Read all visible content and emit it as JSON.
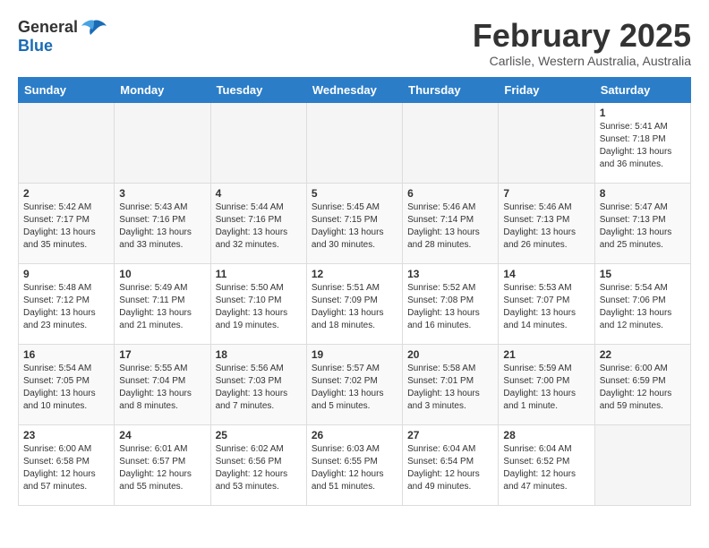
{
  "header": {
    "logo_general": "General",
    "logo_blue": "Blue",
    "title": "February 2025",
    "subtitle": "Carlisle, Western Australia, Australia"
  },
  "calendar": {
    "days_of_week": [
      "Sunday",
      "Monday",
      "Tuesday",
      "Wednesday",
      "Thursday",
      "Friday",
      "Saturday"
    ],
    "weeks": [
      [
        {
          "day": "",
          "info": ""
        },
        {
          "day": "",
          "info": ""
        },
        {
          "day": "",
          "info": ""
        },
        {
          "day": "",
          "info": ""
        },
        {
          "day": "",
          "info": ""
        },
        {
          "day": "",
          "info": ""
        },
        {
          "day": "1",
          "info": "Sunrise: 5:41 AM\nSunset: 7:18 PM\nDaylight: 13 hours\nand 36 minutes."
        }
      ],
      [
        {
          "day": "2",
          "info": "Sunrise: 5:42 AM\nSunset: 7:17 PM\nDaylight: 13 hours\nand 35 minutes."
        },
        {
          "day": "3",
          "info": "Sunrise: 5:43 AM\nSunset: 7:16 PM\nDaylight: 13 hours\nand 33 minutes."
        },
        {
          "day": "4",
          "info": "Sunrise: 5:44 AM\nSunset: 7:16 PM\nDaylight: 13 hours\nand 32 minutes."
        },
        {
          "day": "5",
          "info": "Sunrise: 5:45 AM\nSunset: 7:15 PM\nDaylight: 13 hours\nand 30 minutes."
        },
        {
          "day": "6",
          "info": "Sunrise: 5:46 AM\nSunset: 7:14 PM\nDaylight: 13 hours\nand 28 minutes."
        },
        {
          "day": "7",
          "info": "Sunrise: 5:46 AM\nSunset: 7:13 PM\nDaylight: 13 hours\nand 26 minutes."
        },
        {
          "day": "8",
          "info": "Sunrise: 5:47 AM\nSunset: 7:13 PM\nDaylight: 13 hours\nand 25 minutes."
        }
      ],
      [
        {
          "day": "9",
          "info": "Sunrise: 5:48 AM\nSunset: 7:12 PM\nDaylight: 13 hours\nand 23 minutes."
        },
        {
          "day": "10",
          "info": "Sunrise: 5:49 AM\nSunset: 7:11 PM\nDaylight: 13 hours\nand 21 minutes."
        },
        {
          "day": "11",
          "info": "Sunrise: 5:50 AM\nSunset: 7:10 PM\nDaylight: 13 hours\nand 19 minutes."
        },
        {
          "day": "12",
          "info": "Sunrise: 5:51 AM\nSunset: 7:09 PM\nDaylight: 13 hours\nand 18 minutes."
        },
        {
          "day": "13",
          "info": "Sunrise: 5:52 AM\nSunset: 7:08 PM\nDaylight: 13 hours\nand 16 minutes."
        },
        {
          "day": "14",
          "info": "Sunrise: 5:53 AM\nSunset: 7:07 PM\nDaylight: 13 hours\nand 14 minutes."
        },
        {
          "day": "15",
          "info": "Sunrise: 5:54 AM\nSunset: 7:06 PM\nDaylight: 13 hours\nand 12 minutes."
        }
      ],
      [
        {
          "day": "16",
          "info": "Sunrise: 5:54 AM\nSunset: 7:05 PM\nDaylight: 13 hours\nand 10 minutes."
        },
        {
          "day": "17",
          "info": "Sunrise: 5:55 AM\nSunset: 7:04 PM\nDaylight: 13 hours\nand 8 minutes."
        },
        {
          "day": "18",
          "info": "Sunrise: 5:56 AM\nSunset: 7:03 PM\nDaylight: 13 hours\nand 7 minutes."
        },
        {
          "day": "19",
          "info": "Sunrise: 5:57 AM\nSunset: 7:02 PM\nDaylight: 13 hours\nand 5 minutes."
        },
        {
          "day": "20",
          "info": "Sunrise: 5:58 AM\nSunset: 7:01 PM\nDaylight: 13 hours\nand 3 minutes."
        },
        {
          "day": "21",
          "info": "Sunrise: 5:59 AM\nSunset: 7:00 PM\nDaylight: 13 hours\nand 1 minute."
        },
        {
          "day": "22",
          "info": "Sunrise: 6:00 AM\nSunset: 6:59 PM\nDaylight: 12 hours\nand 59 minutes."
        }
      ],
      [
        {
          "day": "23",
          "info": "Sunrise: 6:00 AM\nSunset: 6:58 PM\nDaylight: 12 hours\nand 57 minutes."
        },
        {
          "day": "24",
          "info": "Sunrise: 6:01 AM\nSunset: 6:57 PM\nDaylight: 12 hours\nand 55 minutes."
        },
        {
          "day": "25",
          "info": "Sunrise: 6:02 AM\nSunset: 6:56 PM\nDaylight: 12 hours\nand 53 minutes."
        },
        {
          "day": "26",
          "info": "Sunrise: 6:03 AM\nSunset: 6:55 PM\nDaylight: 12 hours\nand 51 minutes."
        },
        {
          "day": "27",
          "info": "Sunrise: 6:04 AM\nSunset: 6:54 PM\nDaylight: 12 hours\nand 49 minutes."
        },
        {
          "day": "28",
          "info": "Sunrise: 6:04 AM\nSunset: 6:52 PM\nDaylight: 12 hours\nand 47 minutes."
        },
        {
          "day": "",
          "info": ""
        }
      ]
    ]
  }
}
